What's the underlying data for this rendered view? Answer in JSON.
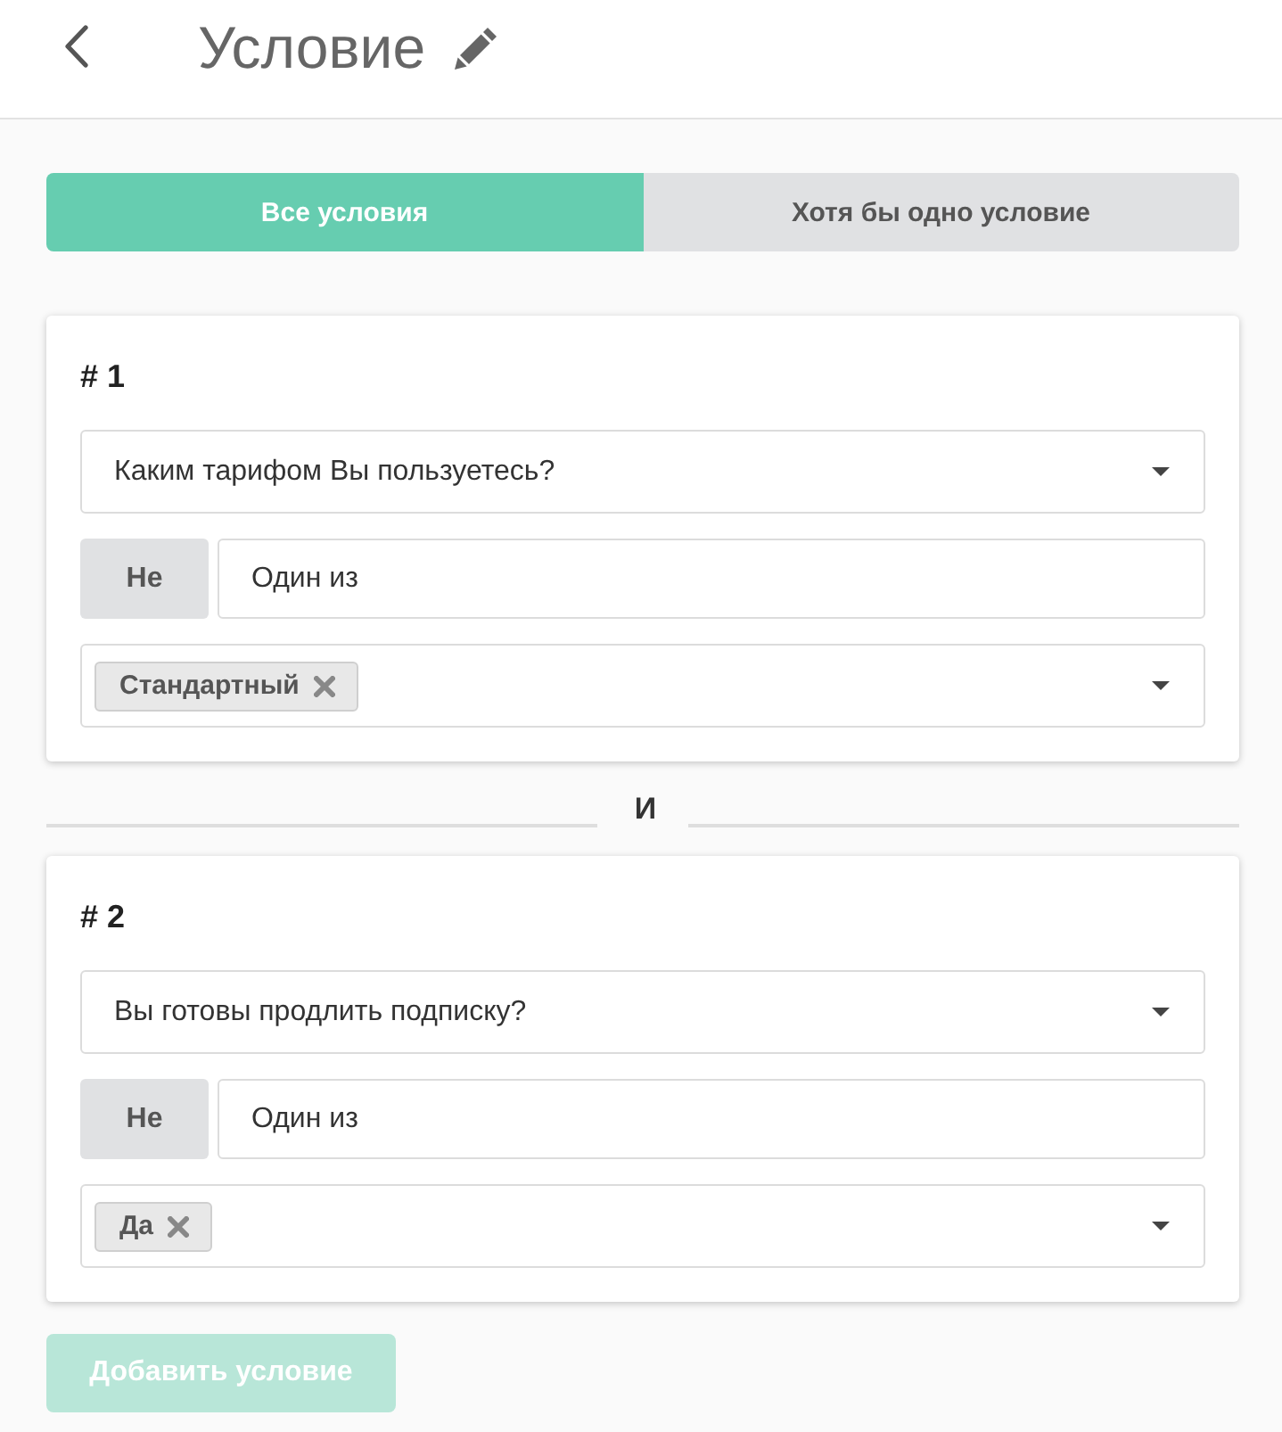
{
  "header": {
    "title": "Условие"
  },
  "match_tabs": [
    {
      "label": "Все условия",
      "selected": true
    },
    {
      "label": "Хотя бы одно условие",
      "selected": false
    }
  ],
  "conditions": [
    {
      "number": "# 1",
      "question": "Каким тарифом Вы пользуетесь?",
      "negate": {
        "label": "Не",
        "selected": false
      },
      "operator": "Один из",
      "values": [
        {
          "label": "Стандартный"
        }
      ]
    },
    {
      "number": "# 2",
      "question": "Вы готовы продлить подписку?",
      "negate": {
        "label": "Не",
        "selected": false
      },
      "operator": "Один из",
      "values": [
        {
          "label": "Да"
        }
      ]
    }
  ],
  "joiner": "И",
  "add_button": {
    "label": "Добавить условие",
    "disabled": true
  }
}
